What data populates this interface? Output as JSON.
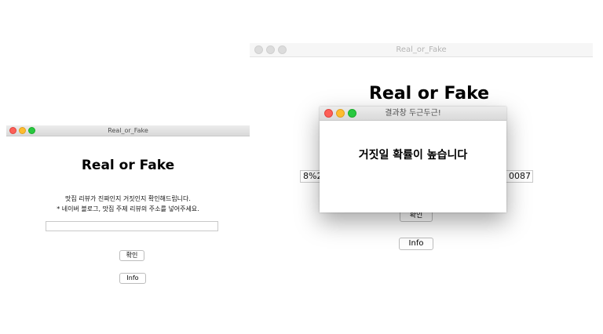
{
  "left_window": {
    "title": "Real_or_Fake",
    "heading": "Real or Fake",
    "desc_line1": "맛집 리뷰가 진짜인지 거짓인지 확인해드립니다.",
    "desc_line2": "* 네이버 블로그, 맛집 주제 리뷰의 주소를 넣어주세요.",
    "url_input_value": "",
    "confirm_label": "확인",
    "info_label": "Info"
  },
  "right_window": {
    "title": "Real_or_Fake",
    "heading": "Real or Fake",
    "url_fragment_left": "8%2",
    "url_fragment_right": "0087",
    "confirm_label": "확인",
    "info_label": "Info"
  },
  "result_dialog": {
    "title": "결과창 두근두근!",
    "message": "거짓일 확률이 높습니다"
  }
}
